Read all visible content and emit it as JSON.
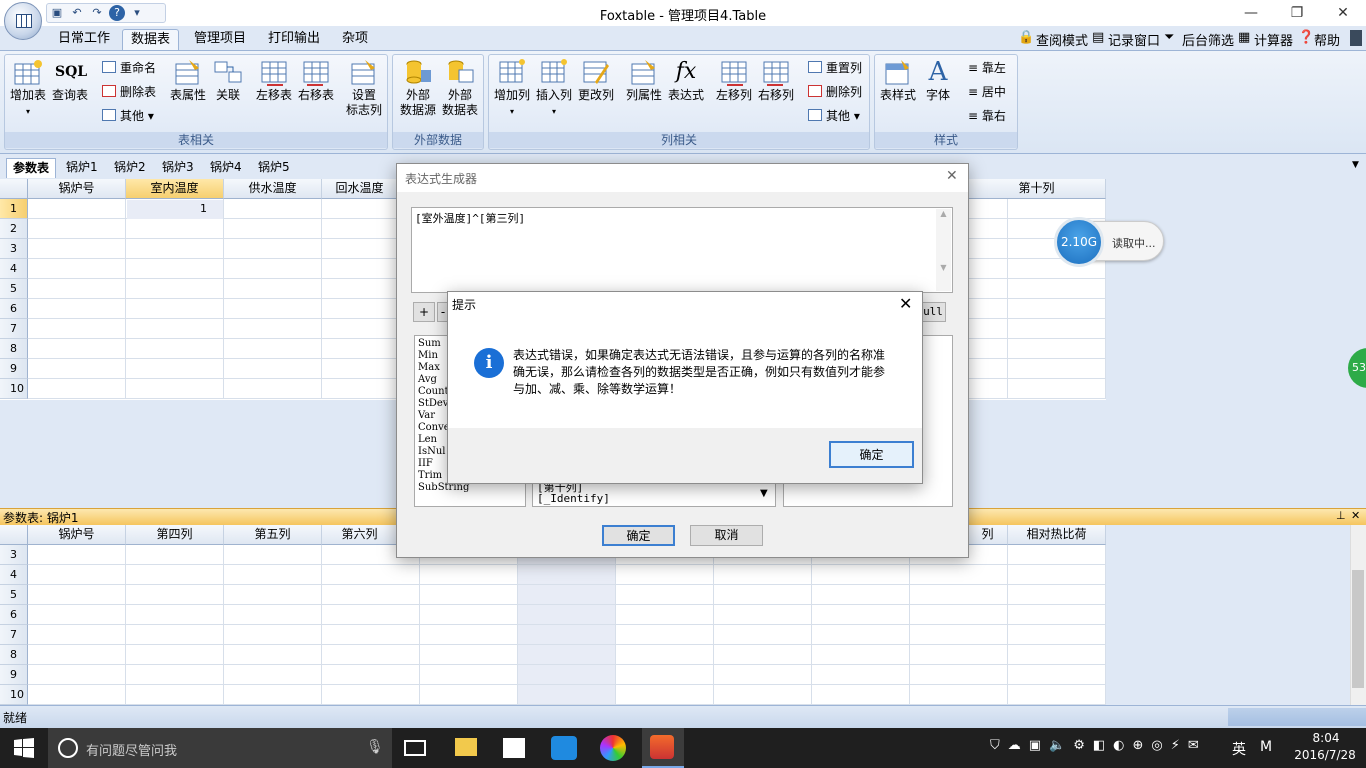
{
  "window": {
    "title": "Foxtable - 管理项目4.Table",
    "minimize": "—",
    "restore": "❐",
    "close": "✕"
  },
  "qat": {
    "icons": [
      "save-icon",
      "undo-icon",
      "redo-icon",
      "help-icon",
      "dropdown-icon"
    ],
    "glyphs": [
      "▣",
      "↶",
      "↷",
      "?",
      "▾"
    ]
  },
  "ribbon_tabs": [
    "日常工作",
    "数据表",
    "管理项目",
    "打印输出",
    "杂项"
  ],
  "ribbon_links": [
    "查阅模式",
    "记录窗口",
    "后台筛选",
    "计算器",
    "帮助"
  ],
  "groups": {
    "table": {
      "label": "表相关",
      "add": "增加表",
      "query": "查询表",
      "sql": "SQL",
      "rename": "重命名",
      "delete": "删除表",
      "other": "其他",
      "props": "表属性",
      "relation": "关联",
      "move_left": "左移表",
      "move_right": "右移表",
      "flag_col": "设置\n标志列"
    },
    "external": {
      "label": "外部数据",
      "source": "外部\n数据源",
      "table": "外部\n数据表"
    },
    "column": {
      "label": "列相关",
      "add": "增加列",
      "insert": "插入列",
      "change": "更改列",
      "props": "列属性",
      "expr": "表达式",
      "move_left": "左移列",
      "move_right": "右移列",
      "reset": "重置列",
      "delete": "删除列",
      "other": "其他"
    },
    "style": {
      "label": "样式",
      "table_style": "表样式",
      "font": "字体",
      "align_left": "靠左",
      "align_center": "居中",
      "align_right": "靠右"
    }
  },
  "sheet_tabs": [
    "参数表",
    "锅炉1",
    "锅炉2",
    "锅炉3",
    "锅炉4",
    "锅炉5"
  ],
  "top_grid": {
    "headers": [
      "锅炉号",
      "室内温度",
      "供水温度",
      "回水温度"
    ],
    "right_header": "第十列",
    "rows": [
      "1",
      "2",
      "3",
      "4",
      "5",
      "6",
      "7",
      "8",
      "9",
      "10"
    ],
    "value": "1"
  },
  "float": {
    "speed": "2.10G",
    "status": "读取中...",
    "side": "53"
  },
  "bottom_panel": {
    "title": "参数表: 锅炉1",
    "pin": "⊥",
    "close": "✕",
    "headers": [
      "锅炉号",
      "第四列",
      "第五列",
      "第六列"
    ],
    "right_headers": [
      "列",
      "相对热比荷"
    ],
    "rows": [
      "3",
      "4",
      "5",
      "6",
      "7",
      "8",
      "9",
      "10"
    ]
  },
  "expr_dialog": {
    "title": "表达式生成器",
    "expression": "[室外温度]^[第三列]",
    "op_plus": "+",
    "op_minus": "-",
    "null_btn": "ull",
    "functions": [
      "Sum",
      "Min",
      "Max",
      "Avg",
      "Count",
      "StDev",
      "Var",
      "Conve",
      "Len",
      "IsNul",
      "IIF",
      "Trim",
      "SubString"
    ],
    "columns": [
      "[第十列]",
      "[_Identify]"
    ],
    "ok": "确定",
    "cancel": "取消"
  },
  "msgbox": {
    "title": "提示",
    "message": "表达式错误，如果确定表达式无语法错误，且参与运算的各列的名称准确无误，那么请检查各列的数据类型是否正确，例如只有数值列才能参与加、减、乘、除等数学运算！",
    "ok": "确定",
    "info": "i"
  },
  "status": {
    "text": "就绪"
  },
  "taskbar": {
    "search": "有问题尽管问我",
    "ime": "英",
    "ime2": "M",
    "time": "8:04",
    "date": "2016/7/28"
  }
}
